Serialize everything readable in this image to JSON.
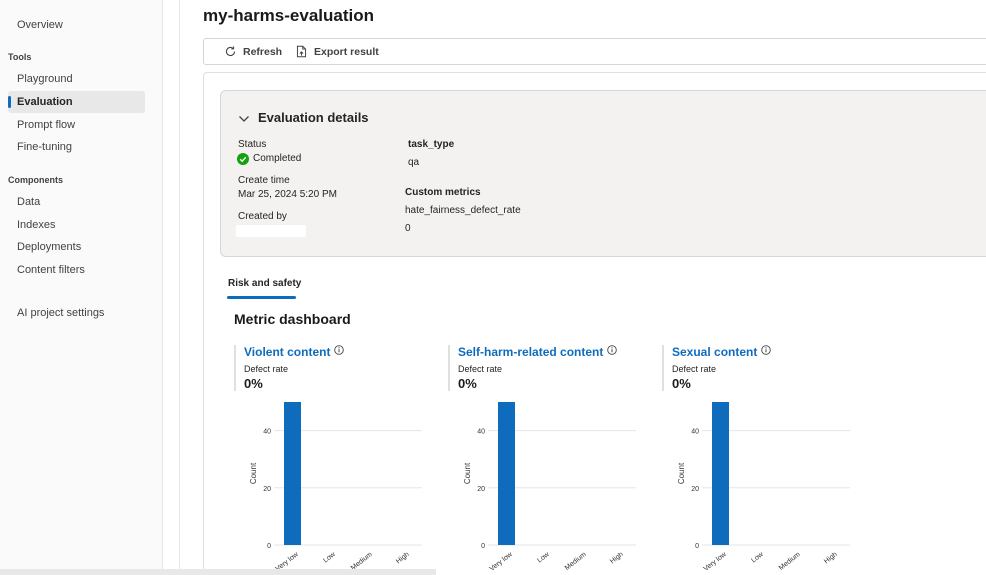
{
  "sidebar": {
    "overview": "Overview",
    "tools_header": "Tools",
    "playground": "Playground",
    "evaluation": "Evaluation",
    "prompt_flow": "Prompt flow",
    "fine_tuning": "Fine-tuning",
    "components_header": "Components",
    "data": "Data",
    "indexes": "Indexes",
    "deployments": "Deployments",
    "content_filters": "Content filters",
    "ai_project_settings": "AI project settings",
    "active_item": "Evaluation"
  },
  "page": {
    "title": "my-harms-evaluation"
  },
  "toolbar": {
    "refresh": "Refresh",
    "export": "Export result"
  },
  "details": {
    "title": "Evaluation details",
    "status_label": "Status",
    "status_value": "Completed",
    "status_color": "#13a10e",
    "create_time_label": "Create time",
    "create_time_value": "Mar 25, 2024 5:20 PM",
    "created_by_label": "Created by",
    "task_type_label": "task_type",
    "task_type_value": "qa",
    "custom_metrics_label": "Custom metrics",
    "custom_metric_name": "hate_fairness_defect_rate",
    "custom_metric_value": "0"
  },
  "tabs": {
    "risk_safety": "Risk and safety"
  },
  "dashboard": {
    "title": "Metric dashboard",
    "accent_color": "#0f6cbd",
    "bar_color": "#0f6cbd"
  },
  "metrics": [
    {
      "title": "Violent content",
      "defect_label": "Defect rate",
      "defect_value": "0%"
    },
    {
      "title": "Self-harm-related content",
      "defect_label": "Defect rate",
      "defect_value": "0%"
    },
    {
      "title": "Sexual content",
      "defect_label": "Defect rate",
      "defect_value": "0%"
    }
  ],
  "chart_data": [
    {
      "type": "bar",
      "categories": [
        "Very low",
        "Low",
        "Medium",
        "High"
      ],
      "values": [
        50,
        0,
        0,
        0
      ],
      "ylabel": "Count",
      "yticks": [
        0,
        20,
        40
      ],
      "ylim": [
        0,
        50
      ]
    },
    {
      "type": "bar",
      "categories": [
        "Very low",
        "Low",
        "Medium",
        "High"
      ],
      "values": [
        50,
        0,
        0,
        0
      ],
      "ylabel": "Count",
      "yticks": [
        0,
        20,
        40
      ],
      "ylim": [
        0,
        50
      ]
    },
    {
      "type": "bar",
      "categories": [
        "Very low",
        "Low",
        "Medium",
        "High"
      ],
      "values": [
        50,
        0,
        0,
        0
      ],
      "ylabel": "Count",
      "yticks": [
        0,
        20,
        40
      ],
      "ylim": [
        0,
        50
      ]
    }
  ]
}
